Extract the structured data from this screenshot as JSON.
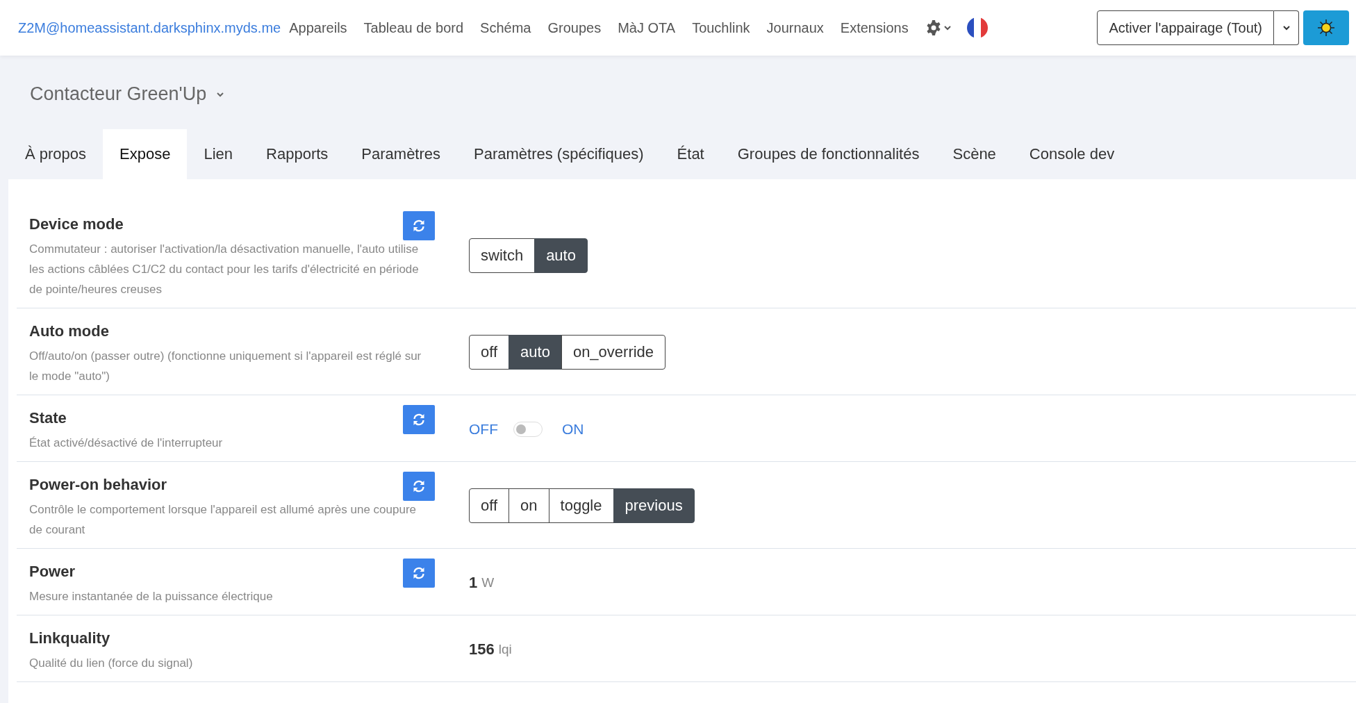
{
  "navbar": {
    "brand": "Z2M@homeassistant.darksphinx.myds.me",
    "links": [
      "Appareils",
      "Tableau de bord",
      "Schéma",
      "Groupes",
      "MàJ OTA",
      "Touchlink",
      "Journaux",
      "Extensions"
    ],
    "pairing_button": "Activer l'appairage (Tout)"
  },
  "device": {
    "name": "Contacteur Green'Up"
  },
  "tabs": [
    {
      "label": "À propos",
      "selected": false
    },
    {
      "label": "Expose",
      "selected": true
    },
    {
      "label": "Lien",
      "selected": false
    },
    {
      "label": "Rapports",
      "selected": false
    },
    {
      "label": "Paramètres",
      "selected": false
    },
    {
      "label": "Paramètres (spécifiques)",
      "selected": false
    },
    {
      "label": "État",
      "selected": false
    },
    {
      "label": "Groupes de fonctionnalités",
      "selected": false
    },
    {
      "label": "Scène",
      "selected": false
    },
    {
      "label": "Console dev",
      "selected": false
    }
  ],
  "rows": [
    {
      "kind": "enum",
      "title": "Device mode",
      "description": "Commutateur : autoriser l'activation/la désactivation manuelle, l'auto utilise les actions câblées C1/C2 du contact pour les tarifs d'électricité en période de pointe/heures creuses",
      "refresh": true,
      "options": [
        {
          "label": "switch",
          "selected": false
        },
        {
          "label": "auto",
          "selected": true
        }
      ]
    },
    {
      "kind": "enum",
      "title": "Auto mode",
      "description": "Off/auto/on (passer outre) (fonctionne uniquement si l'appareil est réglé sur le mode \"auto\")",
      "refresh": false,
      "options": [
        {
          "label": "off",
          "selected": false
        },
        {
          "label": "auto",
          "selected": true
        },
        {
          "label": "on_override",
          "selected": false
        }
      ]
    },
    {
      "kind": "toggle",
      "title": "State",
      "description": "État activé/désactivé de l'interrupteur",
      "refresh": true,
      "off_label": "OFF",
      "on_label": "ON",
      "on": false
    },
    {
      "kind": "enum",
      "title": "Power-on behavior",
      "description": "Contrôle le comportement lorsque l'appareil est allumé après une coupure de courant",
      "refresh": true,
      "options": [
        {
          "label": "off",
          "selected": false
        },
        {
          "label": "on",
          "selected": false
        },
        {
          "label": "toggle",
          "selected": false
        },
        {
          "label": "previous",
          "selected": true
        }
      ]
    },
    {
      "kind": "numeric",
      "title": "Power",
      "description": "Mesure instantanée de la puissance électrique",
      "refresh": true,
      "value": "1",
      "unit": "W"
    },
    {
      "kind": "numeric",
      "title": "Linkquality",
      "description": "Qualité du lien (force du signal)",
      "refresh": false,
      "value": "156",
      "unit": "lqi"
    }
  ]
}
